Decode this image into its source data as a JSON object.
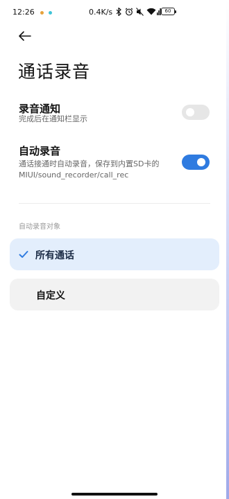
{
  "status_bar": {
    "time": "12:26",
    "speed": "0.4K/s",
    "battery": "60",
    "dot_colors": [
      "#e6a23c",
      "#40c4d8"
    ]
  },
  "page": {
    "title": "通话录音"
  },
  "notify_setting": {
    "title": "录音通知",
    "subtitle": "完成后在通知栏显示",
    "enabled": false
  },
  "auto_record_setting": {
    "title": "自动录音",
    "subtitle_line1": "通话接通时自动录音，保存到内置SD卡的",
    "subtitle_line2": "MIUI/sound_recorder/call_rec",
    "enabled": true
  },
  "target_section": {
    "label": "自动录音对象",
    "options": [
      {
        "label": "所有通话",
        "selected": true
      },
      {
        "label": "自定义",
        "selected": false
      }
    ]
  },
  "colors": {
    "accent": "#2f7be0",
    "selected_bg": "#e3eefc",
    "option_bg": "#f2f2f2",
    "toggle_off": "#e6e6e6"
  },
  "icons": {
    "back": "arrow-left-icon",
    "check": "checkmark-icon",
    "bluetooth": "bluetooth-icon",
    "alarm": "alarm-icon",
    "mute": "mute-icon",
    "wifi": "wifi-icon",
    "signal": "signal-icon"
  }
}
